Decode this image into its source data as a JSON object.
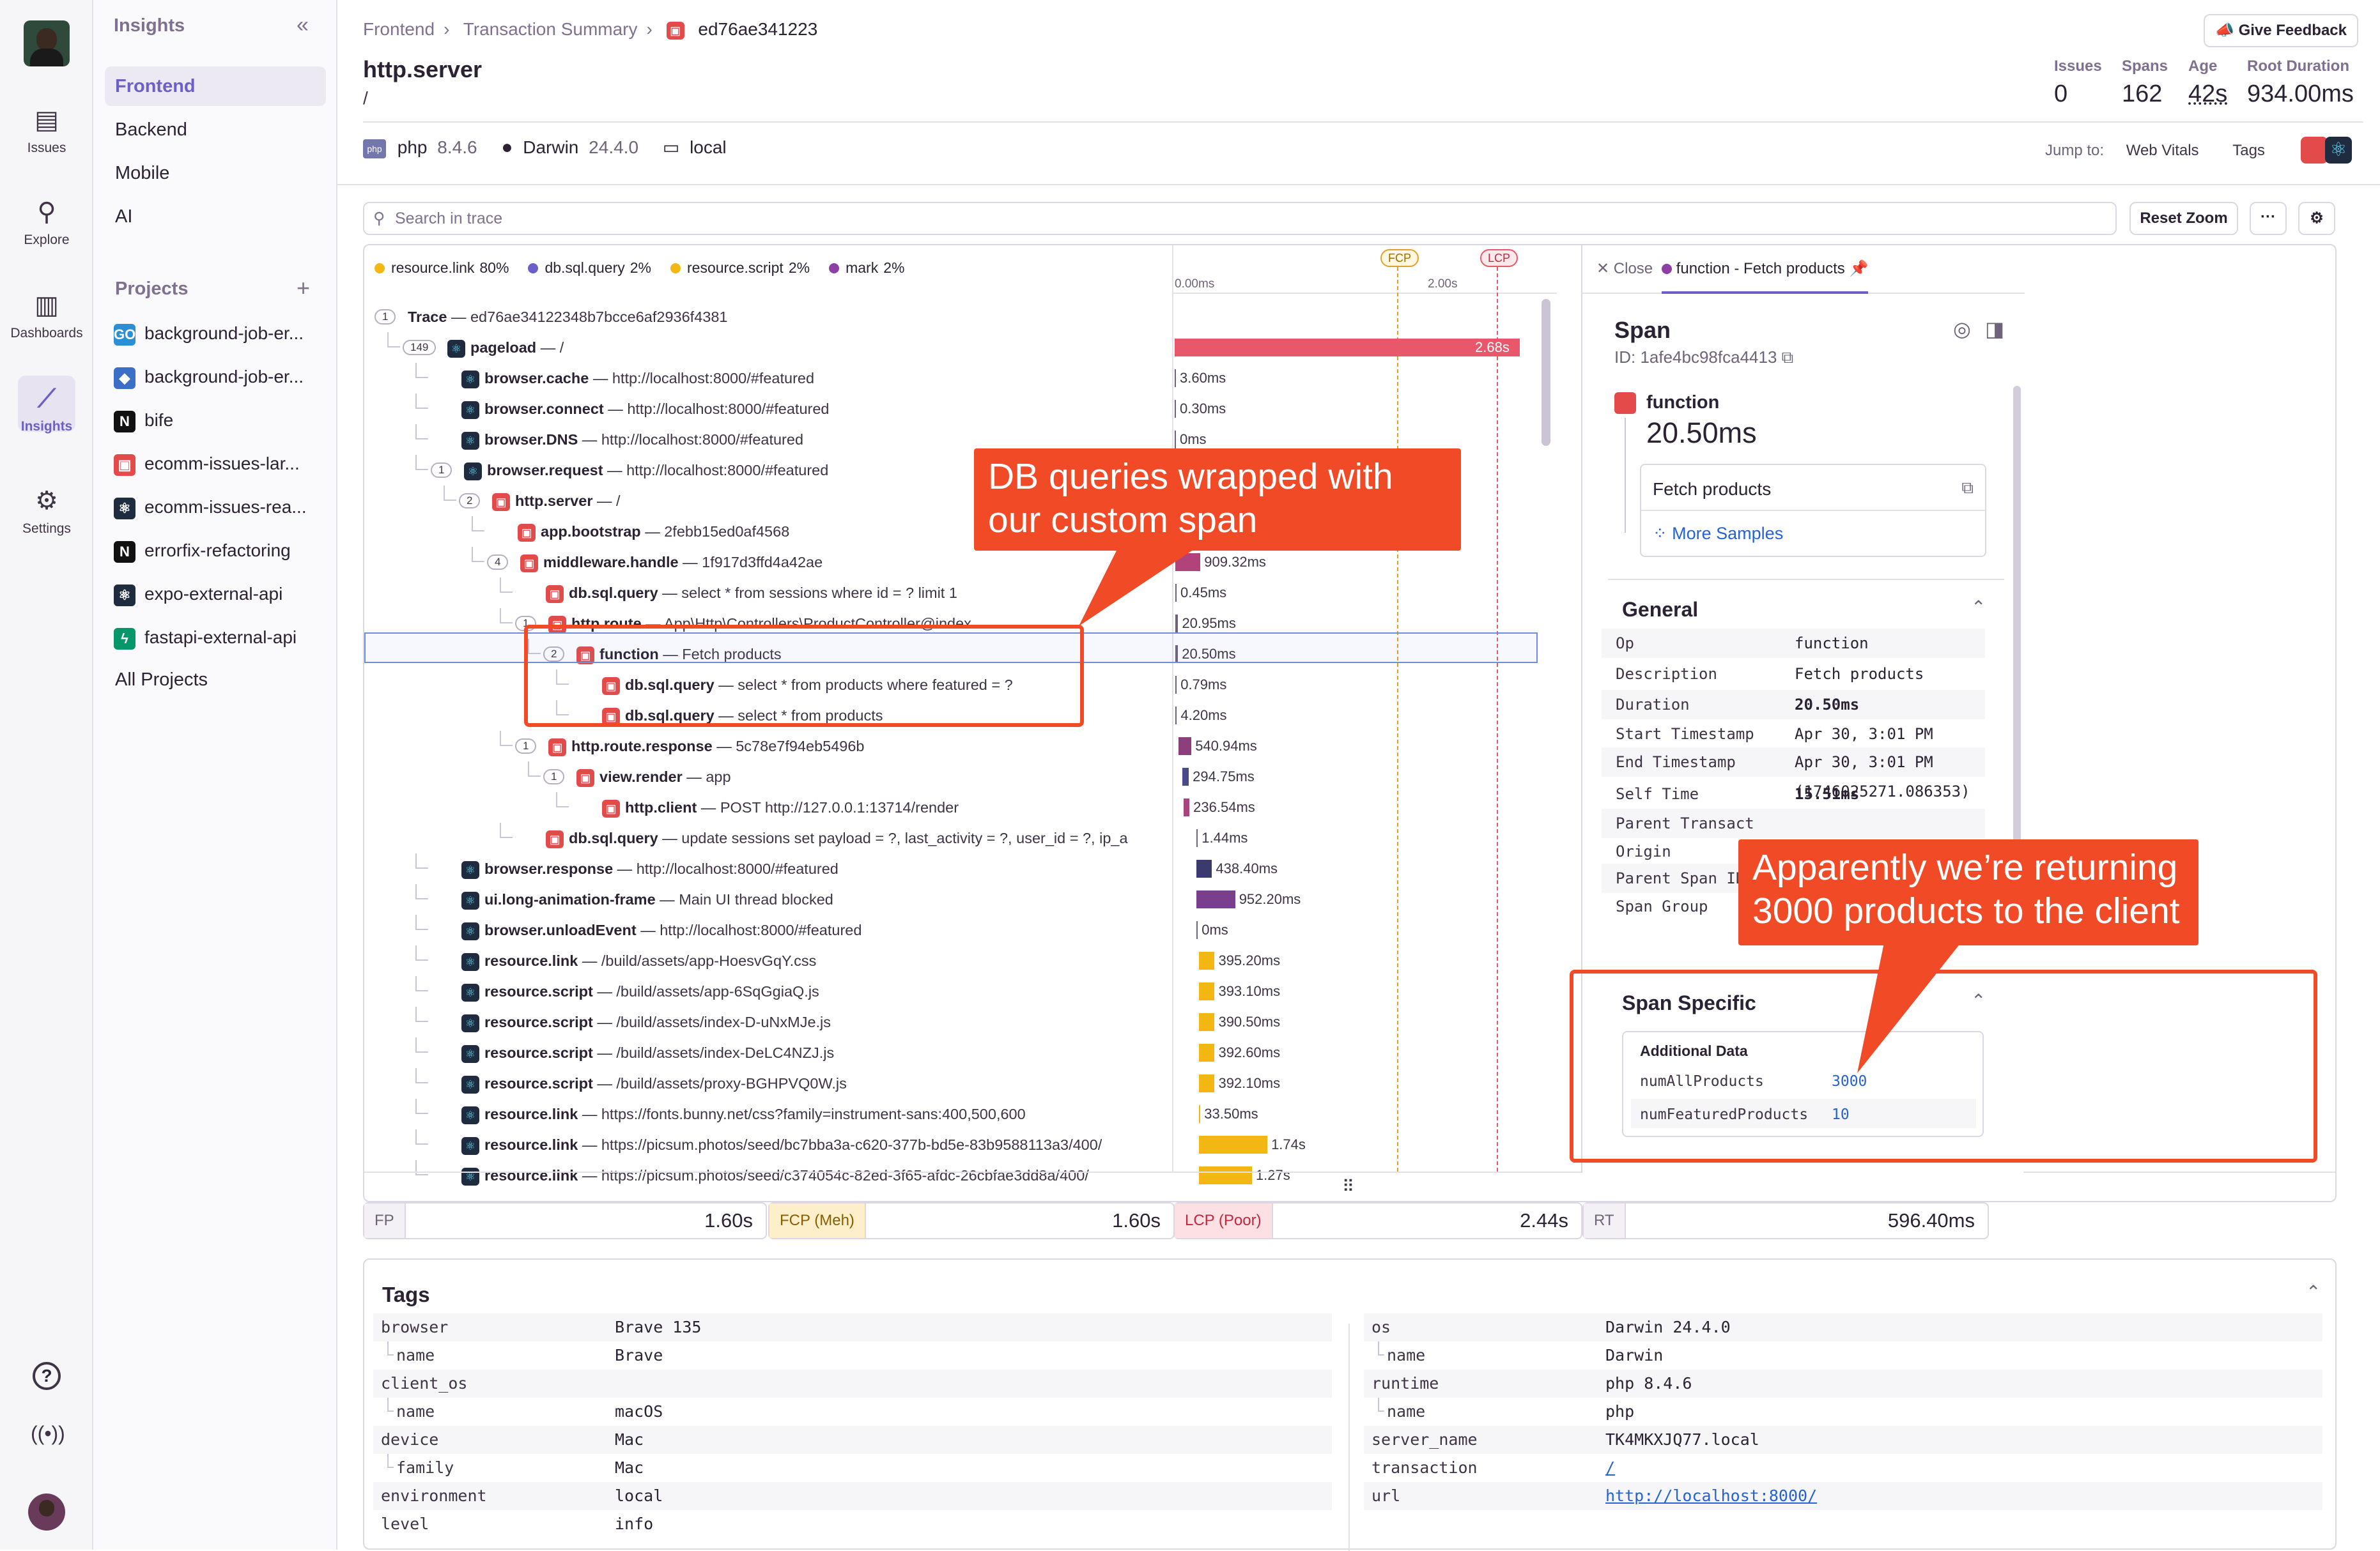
{
  "rail": {
    "items": [
      {
        "label": "Issues",
        "icon": "inbox-icon"
      },
      {
        "label": "Explore",
        "icon": "search-icon"
      },
      {
        "label": "Dashboards",
        "icon": "dashboard-icon"
      },
      {
        "label": "Insights",
        "icon": "insights-icon"
      },
      {
        "label": "Settings",
        "icon": "gear-icon"
      }
    ]
  },
  "sidebar": {
    "title": "Insights",
    "items": [
      "Frontend",
      "Backend",
      "Mobile",
      "AI"
    ],
    "projects_title": "Projects",
    "projects": [
      {
        "name": "background-job-er...",
        "color": "#2b8fd6",
        "glyph": "GO"
      },
      {
        "name": "background-job-er...",
        "color": "#3b6fc7",
        "glyph": "◆"
      },
      {
        "name": "bife",
        "color": "#111111",
        "glyph": "N"
      },
      {
        "name": "ecomm-issues-lar...",
        "color": "#e34b4b",
        "glyph": "▣"
      },
      {
        "name": "ecomm-issues-rea...",
        "color": "#1f2c3f",
        "glyph": "⚛"
      },
      {
        "name": "errorfix-refactoring",
        "color": "#111111",
        "glyph": "N"
      },
      {
        "name": "expo-external-api",
        "color": "#1f2c3f",
        "glyph": "⚛"
      },
      {
        "name": "fastapi-external-api",
        "color": "#059669",
        "glyph": "ϟ"
      }
    ],
    "all_projects": "All Projects"
  },
  "header": {
    "breadcrumb": [
      "Frontend",
      "Transaction Summary",
      "ed76ae341223"
    ],
    "title": "http.server",
    "subtitle": "/",
    "feedback": "Give Feedback",
    "stats": [
      {
        "label": "Issues",
        "value": "0"
      },
      {
        "label": "Spans",
        "value": "162"
      },
      {
        "label": "Age",
        "value": "42s"
      },
      {
        "label": "Root Duration",
        "value": "934.00ms"
      }
    ],
    "platform": [
      {
        "name": "php",
        "version": "8.4.6"
      },
      {
        "name": "Darwin",
        "version": "24.4.0"
      },
      {
        "name": "local",
        "version": ""
      }
    ],
    "jump_to": "Jump to:",
    "jump_links": [
      "Web Vitals",
      "Tags"
    ]
  },
  "search": {
    "placeholder": "Search in trace",
    "reset_zoom": "Reset Zoom",
    "more": "···"
  },
  "legend": [
    {
      "label": "resource.link",
      "pct": "80%",
      "color": "#f2b712"
    },
    {
      "label": "db.sql.query",
      "pct": "2%",
      "color": "#6c5fc7"
    },
    {
      "label": "resource.script",
      "pct": "2%",
      "color": "#f2b712"
    },
    {
      "label": "mark",
      "pct": "2%",
      "color": "#8c3fa5"
    }
  ],
  "timeline": {
    "ticks": [
      "0.00ms",
      "2.00s"
    ],
    "markers": [
      "FCP",
      "LCP"
    ]
  },
  "rows": [
    {
      "chip": "1",
      "op": "Trace",
      "desc": "ed76ae34122348b7bcce6af2936f4381",
      "depth": 0,
      "icon": "none",
      "dur": "",
      "bar": null
    },
    {
      "chip": "149",
      "op": "pageload",
      "desc": "/",
      "depth": 1,
      "icon": "dark",
      "dur": "2.68s",
      "bar": {
        "start": 0,
        "end": 2.68,
        "color": "#e8586a"
      }
    },
    {
      "chip": "",
      "op": "browser.cache",
      "desc": "http://localhost:8000/#featured",
      "depth": 2,
      "icon": "dark",
      "dur": "3.60ms",
      "bar": {
        "start": 0.0,
        "end": 0.0036,
        "color": "#6e6378"
      }
    },
    {
      "chip": "",
      "op": "browser.connect",
      "desc": "http://localhost:8000/#featured",
      "depth": 2,
      "icon": "dark",
      "dur": "0.30ms",
      "bar": {
        "start": 0.0,
        "end": 0.0003,
        "color": "#6e6378"
      }
    },
    {
      "chip": "",
      "op": "browser.DNS",
      "desc": "http://localhost:8000/#featured",
      "depth": 2,
      "icon": "dark",
      "dur": "0ms",
      "bar": {
        "start": 0.0,
        "end": 0.0,
        "color": "#6e6378"
      }
    },
    {
      "chip": "1",
      "op": "browser.request",
      "desc": "http://localhost:8000/#featured",
      "depth": 2,
      "icon": "dark",
      "dur": "",
      "bar": null
    },
    {
      "chip": "2",
      "op": "http.server",
      "desc": "/",
      "depth": 3,
      "icon": "red",
      "dur": "",
      "bar": null
    },
    {
      "chip": "",
      "op": "app.bootstrap",
      "desc": "2febb15ed0af4568",
      "depth": 4,
      "icon": "red",
      "dur": "",
      "bar": null
    },
    {
      "chip": "4",
      "op": "middleware.handle",
      "desc": "1f917d3ffd4a42ae",
      "depth": 4,
      "icon": "red",
      "dur": "909.32ms",
      "bar": {
        "start": 0.005,
        "end": 0.2,
        "color": "#b2437a"
      }
    },
    {
      "chip": "",
      "op": "db.sql.query",
      "desc": "select * from sessions where id = ? limit 1",
      "depth": 5,
      "icon": "red",
      "dur": "0.45ms",
      "bar": {
        "start": 0.005,
        "end": 0.0055,
        "color": "#6e6378"
      }
    },
    {
      "chip": "1",
      "op": "http.route",
      "desc": "App\\Http\\Controllers\\ProductController@index",
      "depth": 5,
      "icon": "red",
      "dur": "20.95ms",
      "bar": {
        "start": 0.006,
        "end": 0.027,
        "color": "#6e6378"
      }
    },
    {
      "chip": "2",
      "op": "function",
      "desc": "Fetch products",
      "depth": 6,
      "icon": "red",
      "dur": "20.50ms",
      "bar": {
        "start": 0.006,
        "end": 0.026,
        "color": "#6e6378"
      },
      "selected": true
    },
    {
      "chip": "",
      "op": "db.sql.query",
      "desc": "select * from products where featured = ?",
      "depth": 7,
      "icon": "red",
      "dur": "0.79ms",
      "bar": {
        "start": 0.006,
        "end": 0.0068,
        "color": "#6e6378"
      }
    },
    {
      "chip": "",
      "op": "db.sql.query",
      "desc": "select * from products",
      "depth": 7,
      "icon": "red",
      "dur": "4.20ms",
      "bar": {
        "start": 0.007,
        "end": 0.011,
        "color": "#6e6378"
      }
    },
    {
      "chip": "1",
      "op": "http.route.response",
      "desc": "5c78e7f94eb5496b",
      "depth": 5,
      "icon": "red",
      "dur": "540.94ms",
      "bar": {
        "start": 0.03,
        "end": 0.13,
        "color": "#8c3f7a"
      }
    },
    {
      "chip": "1",
      "op": "view.render",
      "desc": "app",
      "depth": 6,
      "icon": "red",
      "dur": "294.75ms",
      "bar": {
        "start": 0.06,
        "end": 0.11,
        "color": "#4a4a8a"
      }
    },
    {
      "chip": "",
      "op": "http.client",
      "desc": "POST http://127.0.0.1:13714/render",
      "depth": 7,
      "icon": "red",
      "dur": "236.54ms",
      "bar": {
        "start": 0.07,
        "end": 0.115,
        "color": "#a8447e"
      }
    },
    {
      "chip": "",
      "op": "db.sql.query",
      "desc": "update sessions set payload = ?, last_activity = ?, user_id = ?, ip_a",
      "depth": 5,
      "icon": "red",
      "dur": "1.44ms",
      "bar": {
        "start": 0.17,
        "end": 0.172,
        "color": "#6e6378"
      }
    },
    {
      "chip": "",
      "op": "browser.response",
      "desc": "http://localhost:8000/#featured",
      "depth": 2,
      "icon": "dark",
      "dur": "438.40ms",
      "bar": {
        "start": 0.17,
        "end": 0.29,
        "color": "#3b3a6f"
      }
    },
    {
      "chip": "",
      "op": "ui.long-animation-frame",
      "desc": "Main UI thread blocked",
      "depth": 2,
      "icon": "dark",
      "dur": "952.20ms",
      "bar": {
        "start": 0.17,
        "end": 0.47,
        "color": "#7a3f8c"
      }
    },
    {
      "chip": "",
      "op": "browser.unloadEvent",
      "desc": "http://localhost:8000/#featured",
      "depth": 2,
      "icon": "dark",
      "dur": "0ms",
      "bar": {
        "start": 0.17,
        "end": 0.17,
        "color": "#6e6378"
      }
    },
    {
      "chip": "",
      "op": "resource.link",
      "desc": "/build/assets/app-HoesvGqY.css",
      "depth": 2,
      "icon": "dark",
      "dur": "395.20ms",
      "bar": {
        "start": 0.19,
        "end": 0.31,
        "color": "#f2b712"
      }
    },
    {
      "chip": "",
      "op": "resource.script",
      "desc": "/build/assets/app-6SqGgiaQ.js",
      "depth": 2,
      "icon": "dark",
      "dur": "393.10ms",
      "bar": {
        "start": 0.19,
        "end": 0.31,
        "color": "#f2b712"
      }
    },
    {
      "chip": "",
      "op": "resource.script",
      "desc": "/build/assets/index-D-uNxMJe.js",
      "depth": 2,
      "icon": "dark",
      "dur": "390.50ms",
      "bar": {
        "start": 0.19,
        "end": 0.31,
        "color": "#f2b712"
      }
    },
    {
      "chip": "",
      "op": "resource.script",
      "desc": "/build/assets/index-DeLC4NZJ.js",
      "depth": 2,
      "icon": "dark",
      "dur": "392.60ms",
      "bar": {
        "start": 0.19,
        "end": 0.31,
        "color": "#f2b712"
      }
    },
    {
      "chip": "",
      "op": "resource.script",
      "desc": "/build/assets/proxy-BGHPVQ0W.js",
      "depth": 2,
      "icon": "dark",
      "dur": "392.10ms",
      "bar": {
        "start": 0.19,
        "end": 0.31,
        "color": "#f2b712"
      }
    },
    {
      "chip": "",
      "op": "resource.link",
      "desc": "https://fonts.bunny.net/css?family=instrument-sans:400,500,600",
      "depth": 2,
      "icon": "dark",
      "dur": "33.50ms",
      "bar": {
        "start": 0.19,
        "end": 0.2,
        "color": "#f2b712"
      }
    },
    {
      "chip": "",
      "op": "resource.link",
      "desc": "https://picsum.photos/seed/bc7bba3a-c620-377b-bd5e-83b9588113a3/400/",
      "depth": 2,
      "icon": "dark",
      "dur": "1.74s",
      "bar": {
        "start": 0.19,
        "end": 0.72,
        "color": "#f2b712"
      }
    },
    {
      "chip": "",
      "op": "resource.link",
      "desc": "https://picsum.photos/seed/c374054c-82ed-3f65-afdc-26cbfae3dd8a/400/",
      "depth": 2,
      "icon": "dark",
      "dur": "1.27s",
      "bar": {
        "start": 0.19,
        "end": 0.6,
        "color": "#f2b712"
      }
    }
  ],
  "detail": {
    "close": "Close",
    "tab": "function - Fetch products",
    "heading": "Span",
    "id": "ID: 1afe4bc98fca4413",
    "op": "function",
    "duration": "20.50ms",
    "description": "Fetch products",
    "more_samples": "More Samples",
    "general_title": "General",
    "general": [
      {
        "k": "Op",
        "v": "function"
      },
      {
        "k": "Description",
        "v": "Fetch products"
      },
      {
        "k": "Duration",
        "v": "20.50ms"
      },
      {
        "k": "Start Timestamp",
        "v": "Apr 30, 3:01 PM (1746025271.065850)"
      },
      {
        "k": "End Timestamp",
        "v": "Apr 30, 3:01 PM (1746025271.086353)"
      },
      {
        "k": "Self Time",
        "v": "15.51ms"
      },
      {
        "k": "Parent Transact",
        "v": ""
      },
      {
        "k": "Origin",
        "v": ""
      },
      {
        "k": "Parent Span ID",
        "v": ""
      },
      {
        "k": "Span Group",
        "v": ""
      }
    ],
    "specific_title": "Span Specific",
    "additional_title": "Additional Data",
    "additional": [
      {
        "k": "numAllProducts",
        "v": "3000"
      },
      {
        "k": "numFeaturedProducts",
        "v": "10"
      }
    ]
  },
  "vitals": [
    {
      "tag": "FP",
      "value": "1.60s"
    },
    {
      "tag": "FCP (Meh)",
      "value": "1.60s"
    },
    {
      "tag": "LCP (Poor)",
      "value": "2.44s"
    },
    {
      "tag": "RT",
      "value": "596.40ms"
    }
  ],
  "tags": {
    "title": "Tags",
    "left": [
      {
        "k": "browser",
        "v": "Brave 135",
        "sub": false
      },
      {
        "k": "name",
        "v": "Brave",
        "sub": true
      },
      {
        "k": "client_os",
        "v": "",
        "sub": false
      },
      {
        "k": "name",
        "v": "macOS",
        "sub": true
      },
      {
        "k": "device",
        "v": "Mac",
        "sub": false
      },
      {
        "k": "family",
        "v": "Mac",
        "sub": true
      },
      {
        "k": "environment",
        "v": "local",
        "sub": false
      },
      {
        "k": "level",
        "v": "info",
        "sub": false
      }
    ],
    "right": [
      {
        "k": "os",
        "v": "Darwin 24.4.0",
        "sub": false
      },
      {
        "k": "name",
        "v": "Darwin",
        "sub": true
      },
      {
        "k": "runtime",
        "v": "php 8.4.6",
        "sub": false
      },
      {
        "k": "name",
        "v": "php",
        "sub": true
      },
      {
        "k": "server_name",
        "v": "TK4MKXJQ77.local",
        "sub": false
      },
      {
        "k": "transaction",
        "v": "/",
        "sub": false,
        "link": true
      },
      {
        "k": "url",
        "v": "http://localhost:8000/",
        "sub": false,
        "link": true
      }
    ]
  },
  "annotations": {
    "db_callout": "DB queries wrapped with our custom span",
    "products_callout": "Apparently we’re returning 3000 products to the client"
  }
}
